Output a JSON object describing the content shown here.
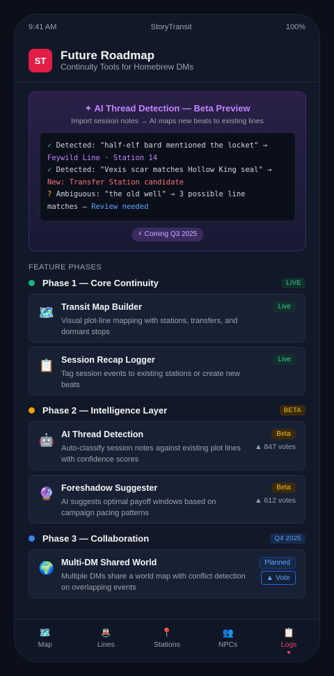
{
  "status": {
    "time": "9:41 AM",
    "app": "StoryTransit",
    "battery": "100%"
  },
  "header": {
    "logo": "ST",
    "title": "Future Roadmap",
    "subtitle": "Continuity Tools for Homebrew DMs"
  },
  "ai_preview": {
    "title": "✦ AI Thread Detection — Beta Preview",
    "subtitle": "Import session notes → AI maps new beats to existing lines",
    "lines": [
      {
        "mark": "✓",
        "text": " Detected: \"half-elf bard mentioned the locket\" →",
        "cont": "Feywild Line · Station 14"
      },
      {
        "mark": "✓",
        "text": " Detected: \"Vexis scar matches Hollow King seal\" →",
        "cont": "New: Transfer Station candidate"
      },
      {
        "mark": "?",
        "text": " Ambiguous: \"the old well\" → 3 possible line",
        "cont_prefix": "matches — ",
        "cont": "Review needed"
      }
    ],
    "coming": "⚡ Coming Q3 2025"
  },
  "section_label": "FEATURE PHASES",
  "phases": [
    {
      "name": "Phase 1 — Core Continuity",
      "badge": "LIVE",
      "color": "#10b981"
    },
    {
      "name": "Phase 2 — Intelligence Layer",
      "badge": "BETA",
      "color": "#f59e0b"
    },
    {
      "name": "Phase 3 — Collaboration",
      "badge": "Q4 2025",
      "color": "#3b82f6"
    }
  ],
  "features": [
    {
      "icon": "🗺️",
      "icon_name": "map-icon",
      "title": "Transit Map Builder",
      "desc": "Visual plot-line mapping with stations, transfers, and dormant stops",
      "badge": "Live"
    },
    {
      "icon": "📋",
      "icon_name": "clipboard-icon",
      "title": "Session Recap Logger",
      "desc": "Tag session events to existing stations or create new beats",
      "badge": "Live"
    },
    {
      "icon": "🤖",
      "icon_name": "robot-icon",
      "title": "AI Thread Detection",
      "desc": "Auto-classify session notes against existing plot lines with confidence scores",
      "badge": "Beta",
      "votes": "▲ 847 votes"
    },
    {
      "icon": "🔮",
      "icon_name": "crystal-ball-icon",
      "title": "Foreshadow Suggester",
      "desc": "AI suggests optimal payoff windows based on campaign pacing patterns",
      "badge": "Beta",
      "votes": "▲ 612 votes"
    },
    {
      "icon": "🌍",
      "icon_name": "globe-icon",
      "title": "Multi-DM Shared World",
      "desc": "Multiple DMs share a world map with conflict detection on overlapping events",
      "badge": "Planned",
      "vote_label": "▲ Vote"
    }
  ],
  "tabs": [
    {
      "icon": "🗺️",
      "label": "Map"
    },
    {
      "icon": "🚇",
      "label": "Lines"
    },
    {
      "icon": "📍",
      "label": "Stations"
    },
    {
      "icon": "👥",
      "label": "NPCs"
    },
    {
      "icon": "📋",
      "label": "Logs"
    }
  ],
  "colors": {
    "accent": "#f43f5e",
    "live": "#34d399",
    "beta": "#fbbf24",
    "planned": "#60a5fa",
    "ai": "#c084fc"
  }
}
